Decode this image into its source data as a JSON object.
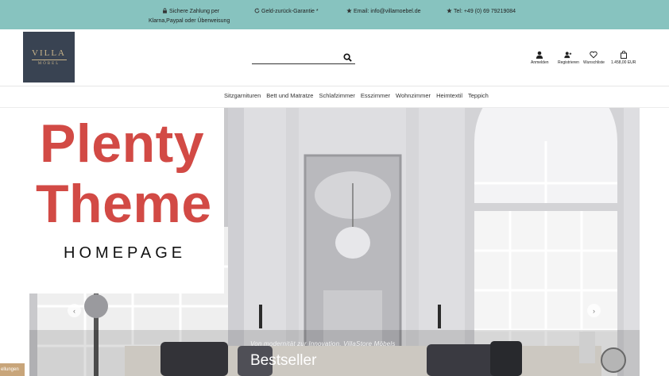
{
  "topbar": {
    "payment_line1": "Sichere Zahlung per",
    "payment_line2": "Klarna,Paypal oder Überweisung",
    "money_back": "Geld-zurück-Garantie *",
    "email": "Email: info@villamoebel.de",
    "phone": "Tel: +49 (0) 69 79219084",
    "bg_color": "#87c3bf"
  },
  "logo": {
    "main": "VILLA",
    "sub": "MÖBEL"
  },
  "search": {
    "placeholder": "",
    "value": ""
  },
  "header_actions": {
    "login": "Anmelden",
    "register": "Registrieren",
    "wishlist": "Wunschliste",
    "cart_total": "1.458,00 EUR"
  },
  "nav": {
    "items": [
      "Sitzgarnituren",
      "Bett und Matratze",
      "Schlafzimmer",
      "Esszimmer",
      "Wohnzimmer",
      "Heimtextil",
      "Teppich"
    ]
  },
  "hero": {
    "subtitle": "Von modernität zur Innovation. VillaStore Möbels",
    "title": "Bestseller",
    "prev": "‹",
    "next": "›"
  },
  "overlay": {
    "line1": "Plenty",
    "line2": "Theme",
    "line3": "HOMEPAGE",
    "accent_color": "#d24a45"
  },
  "cookie_tab": {
    "label": "ellungen"
  }
}
